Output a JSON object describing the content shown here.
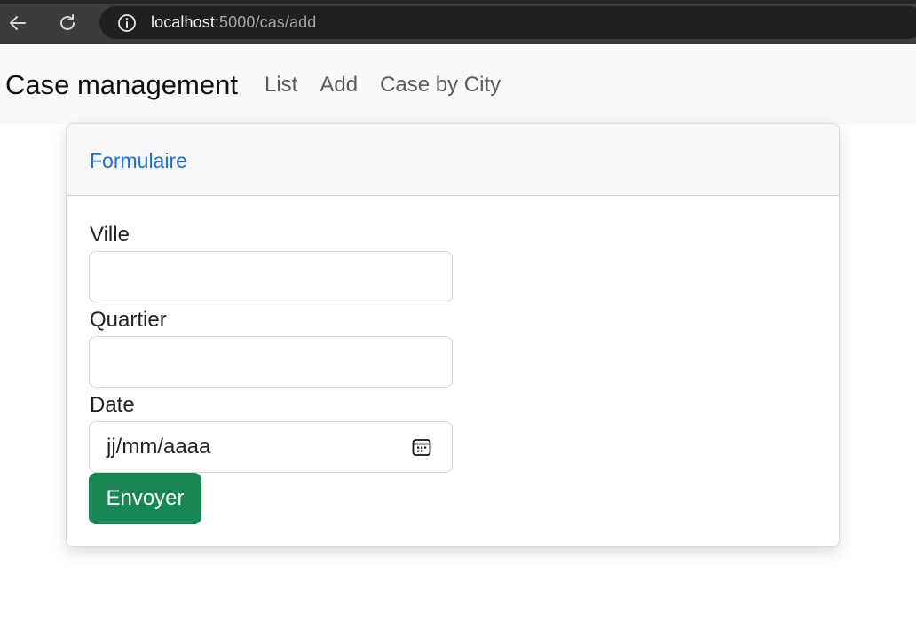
{
  "browser": {
    "url_host": "localhost",
    "url_path": ":5000/cas/add",
    "icons": {
      "back": "arrow-left-icon",
      "reload": "reload-icon",
      "site_info": "info-icon"
    }
  },
  "navbar": {
    "brand": "Case management",
    "links": [
      {
        "label": "List"
      },
      {
        "label": "Add"
      },
      {
        "label": "Case by City"
      }
    ]
  },
  "card": {
    "title": "Formulaire",
    "title_color": "#1f6fd1"
  },
  "form": {
    "ville_label": "Ville",
    "ville_value": "",
    "quartier_label": "Quartier",
    "quartier_value": "",
    "date_label": "Date",
    "date_placeholder": "jj/mm/aaaa",
    "submit_label": "Envoyer",
    "submit_color": "#198754",
    "calendar_icon": "calendar-icon"
  }
}
